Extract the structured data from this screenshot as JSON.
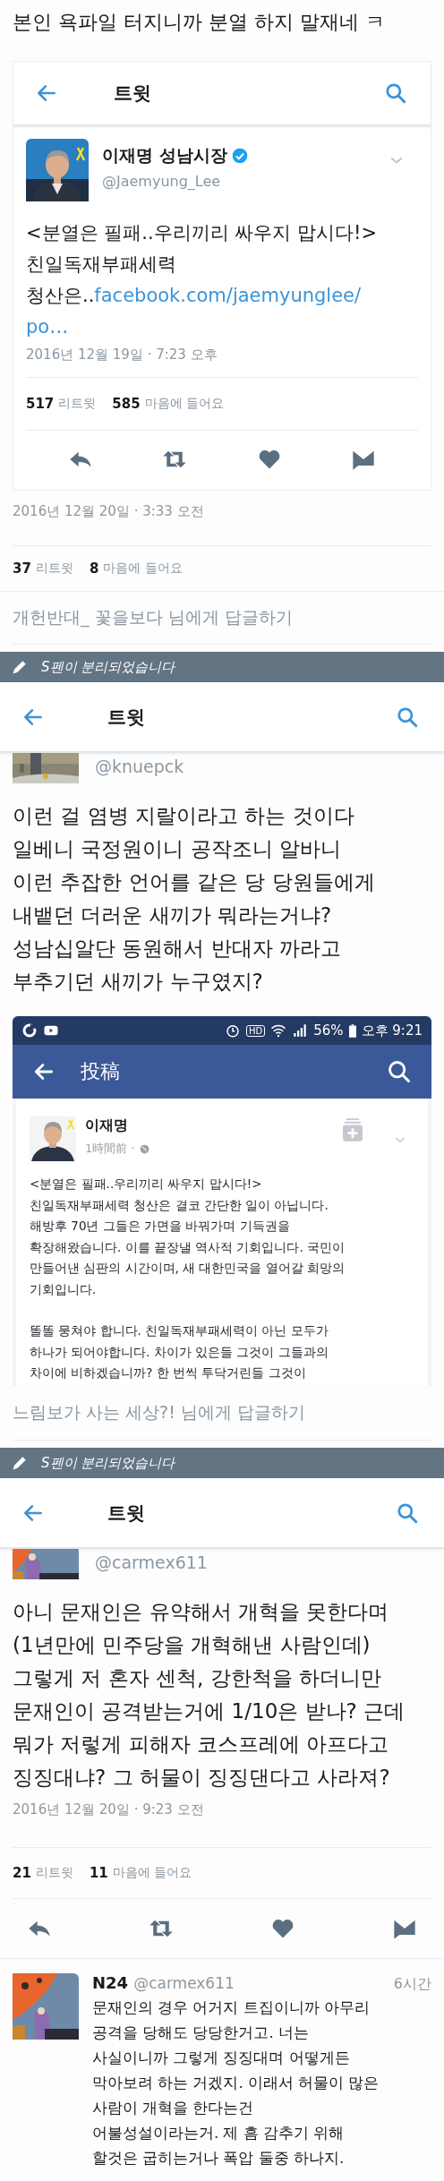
{
  "post_title": "본인 욕파일 터지니까 분열 하지 말재네 ㅋ",
  "screen_1": {
    "header": {
      "title": "트윗"
    },
    "tweet": {
      "name": "이재명 성남시장",
      "verified": true,
      "handle": "@Jaemyung_Lee",
      "text_lines": [
        "<분열은 필패..우리끼리 싸우지 맙시다!>",
        "친일독재부패세력"
      ],
      "text_before_link": "청산은..",
      "link_lines": [
        "facebook.com/jaemyunglee/",
        "po…"
      ],
      "date": "2016년 12월 19일 · 7:23 오후",
      "stats": [
        {
          "count": "517",
          "label": "리트윗"
        },
        {
          "count": "585",
          "label": "마음에 들어요"
        }
      ],
      "actions": [
        {
          "kind": "reply"
        },
        {
          "kind": "retweet"
        },
        {
          "kind": "like"
        },
        {
          "kind": "message"
        }
      ]
    },
    "date": "2016년 12월 20일 · 3:33 오전",
    "stats": [
      {
        "count": "37",
        "label": "리트윗"
      },
      {
        "count": "8",
        "label": "마음에 들어요"
      }
    ],
    "reply_prompt": "개헌반대_ 꽃을보다 님에게 답글하기"
  },
  "spen_notice_1": "S펜이 분리되었습니다",
  "screen_2": {
    "header": {
      "title": "트윗"
    },
    "handle": "@knuepck",
    "text_lines": [
      "이런 걸 염병 지랄이라고 하는 것이다",
      "일베니 국정원이니 공작조니 알바니",
      "이런 추잡한 언어를 같은 당 당원들에게",
      "내뱉던 더러운 새끼가 뭐라는거냐?",
      "성남십알단 동원해서 반대자 까라고",
      "부추기던 새끼가 누구였지?"
    ],
    "embedded_screenshot": {
      "status_bar": {
        "hd": "HD",
        "battery": "56%",
        "time": "오후 9:21"
      },
      "header": {
        "title": "投稿"
      },
      "post": {
        "author": "이재명",
        "time": "1時間前 ·",
        "paragraphs": [
          [
            "<분열은 필패..우리끼리 싸우지 맙시다!>",
            "친일독재부패세력 청산은 결코 간단한 일이 아닙니다.",
            "해방후 70년 그들은 가면을 바꿔가며 기득권을",
            "확장해왔습니다. 이를 끝장낼 역사적 기회입니다. 국민이",
            "만들어낸 심판의 시간이며, 새 대한민국을 열어갈 희망의",
            "기회입니다."
          ],
          [
            "똘똘 뭉쳐야 합니다. 친일독재부패세력이 아닌 모두가",
            "하나가 되어야합니다. 차이가 있은들 그것이 그들과의",
            "차이에 비하겠습니까? 한 번씩 투닥거린들 그것이"
          ]
        ]
      }
    },
    "reply_prompt": "느림보가 사는 세상?! 님에게 답글하기"
  },
  "spen_notice_2": "S펜이 분리되었습니다",
  "screen_3": {
    "header": {
      "title": "트윗"
    },
    "handle": "@carmex611",
    "text_lines": [
      "아니 문재인은 유약해서 개혁을 못한다며",
      "(1년만에 민주당을 개혁해낸 사람인데)",
      "그렇게 저 혼자 센척, 강한척을 하더니만",
      "문재인이 공격받는거에 1/10은 받나? 근데",
      "뭐가 저렇게 피해자 코스프레에 아프다고",
      "징징대냐? 그 허물이 징징댄다고 사라져?"
    ],
    "date": "2016년 12월 20일 · 9:23 오전",
    "stats": [
      {
        "count": "21",
        "label": "리트윗"
      },
      {
        "count": "11",
        "label": "마음에 들어요"
      }
    ],
    "actions": [
      {
        "kind": "reply"
      },
      {
        "kind": "retweet"
      },
      {
        "kind": "like"
      },
      {
        "kind": "message"
      }
    ],
    "reply": {
      "name": "N24",
      "handle": "@carmex611",
      "time": "6시간",
      "text_lines": [
        "문재인의 경우 어거지 트집이니까 아무리",
        "공격을 당해도 당당한거고. 너는",
        "사실이니까 그렇게 징징대며 어떻게든",
        "막아보려 하는 거겠지. 이래서 허물이 많은",
        "사람이 개혁을 한다는건",
        "어불성설이라는거. 제 흠 감추기 위해",
        "할것은 굽히는거나 폭압 둘중 하나지."
      ]
    }
  }
}
